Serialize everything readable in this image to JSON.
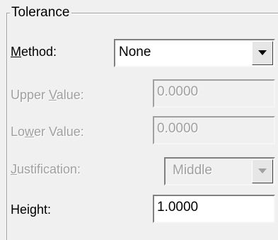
{
  "group": {
    "title": "Tolerance"
  },
  "method": {
    "label_prefix": "",
    "label_accel": "M",
    "label_rest": "ethod:",
    "value": "None"
  },
  "upper_value": {
    "label_prefix": "Upper ",
    "label_accel": "V",
    "label_rest": "alue:",
    "value": "0.0000"
  },
  "lower_value": {
    "label_prefix": "Lo",
    "label_accel": "w",
    "label_rest": "er Value:",
    "value": "0.0000"
  },
  "justification": {
    "label_prefix": "",
    "label_accel": "J",
    "label_rest": "ustification:",
    "value": "Middle"
  },
  "height": {
    "label_prefix": "Hei",
    "label_accel": "g",
    "label_rest": "ht:",
    "value": "1.0000"
  }
}
